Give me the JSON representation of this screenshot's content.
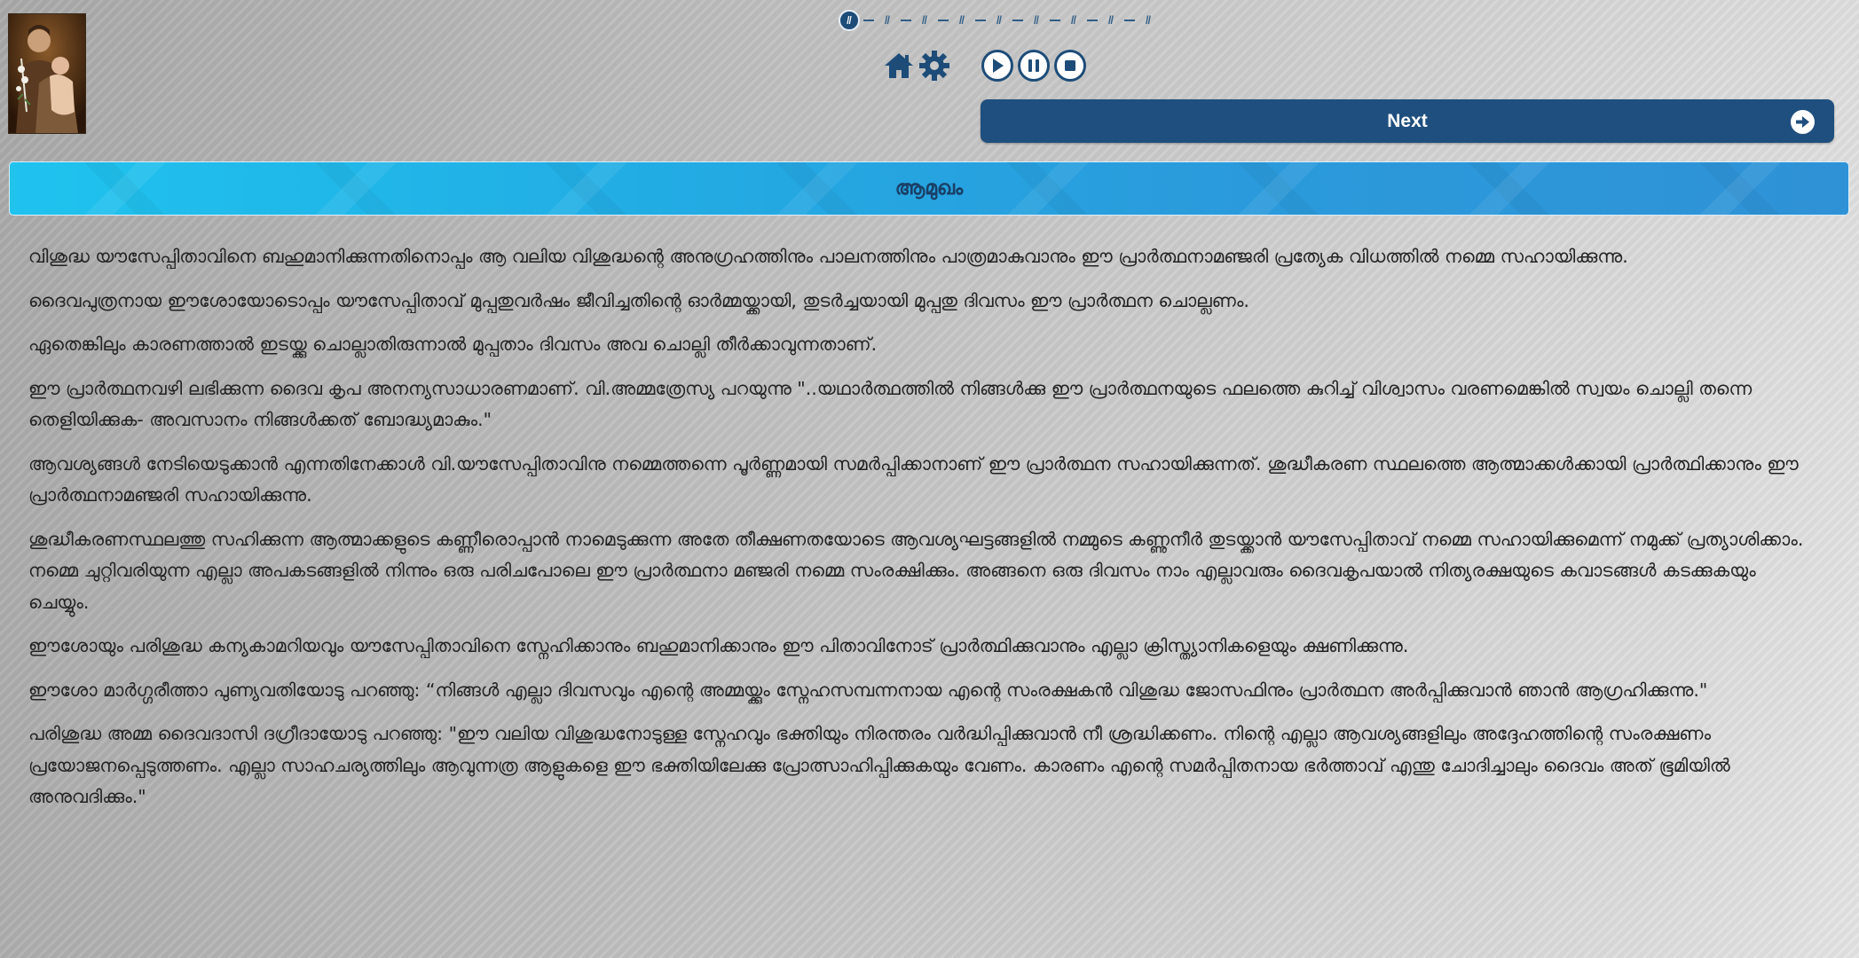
{
  "progress": {
    "steps": [
      "ǁ",
      "ǁ",
      "ǁ",
      "ǁ",
      "ǁ",
      "ǁ",
      "ǁ",
      "ǁ",
      "ǁ"
    ],
    "active_index": 0
  },
  "toolbar": {
    "icons": [
      "home-icon",
      "settings-icon"
    ],
    "media": [
      "play-icon",
      "pause-icon",
      "stop-icon"
    ]
  },
  "next_button": {
    "label": "Next"
  },
  "header": {
    "title": "ആമുഖം"
  },
  "paragraphs": [
    "വിശുദ്ധ യൗസേപ്പിതാവിനെ ബഹുമാനിക്കുന്നതിനൊപ്പം ആ വലിയ വിശുദ്ധന്റെ അനുഗ്രഹത്തിനും പാലനത്തിനും പാത്രമാകുവാനും ഈ പ്രാർത്ഥനാമഞ്ജരി പ്രത്യേക വിധത്തിൽ നമ്മെ സഹായിക്കുന്നു.",
    "ദൈവപുത്രനായ ഈശോയോടൊപ്പം യൗസേപ്പിതാവ് മുപ്പതുവർഷം ജീവിച്ചതിന്റെ ഓർമ്മയ്ക്കായി,  തുടർച്ചയായി മുപ്പതു ദിവസം ഈ പ്രാർത്ഥന ചൊല്ലണം.",
    "ഏതെങ്കിലും കാരണത്താൽ ഇടയ്ക്കു ചൊല്ലാതിരുന്നാൽ മുപ്പതാം ദിവസം അവ ചൊല്ലി തീർക്കാവുന്നതാണ്.",
    "ഈ പ്രാർത്ഥനവഴി ലഭിക്കുന്ന ദൈവ കൃപ അനന്യസാധാരണമാണ്. വി.അമ്മത്രേസ്യ പറയുന്നു \"..യഥാർത്ഥത്തിൽ നിങ്ങൾക്കു ഈ പ്രാർത്ഥനയുടെ  ഫലത്തെ കുറിച്ച്  വിശ്വാസം വരണമെങ്കിൽ സ്വയം ചൊല്ലി തന്നെ തെളിയിക്കുക- അവസാനം നിങ്ങൾക്കത് ബോദ്ധ്യമാകും.\"",
    "ആവശ്യങ്ങൾ നേടിയെടുക്കാൻ എന്നതിനേക്കാൾ വി.യൗസേപ്പിതാവിനു  നമ്മെത്തന്നെ പൂർണ്ണമായി സമർപ്പിക്കാനാണ് ഈ പ്രാർത്ഥന സഹായിക്കുന്നത്. ശുദ്ധീകരണ സ്ഥലത്തെ ആത്മാക്കൾക്കായി പ്രാർത്ഥിക്കാനും ഈ പ്രാർത്ഥനാമഞ്ജരി സഹായിക്കുന്നു.",
    "ശുദ്ധീകരണസ്ഥലത്തു സഹിക്കുന്ന ആത്മാക്കളുടെ കണ്ണീരൊപ്പാൻ നാമെടുക്കുന്ന  അതേ തീക്ഷണതയോടെ ആവശ്യഘട്ടങ്ങളിൽ നമ്മുടെ കണ്ണുനീർ തുടയ്ക്കാൻ യൗസേപ്പിതാവ് നമ്മെ സഹായിക്കുമെന്ന് നമുക്ക് പ്രത്യാശിക്കാം. നമ്മെ ചുറ്റിവരിയുന്ന എല്ലാ അപകടങ്ങളിൽ നിന്നും ഒരു പരിചപോലെ ഈ പ്രാർത്ഥനാ മഞ്ജരി നമ്മെ സംരക്ഷിക്കും. അങ്ങനെ ഒരു ദിവസം നാം എല്ലാവരും ദൈവകൃപയാൽ നിത്യരക്ഷയുടെ കവാടങ്ങൾ കടക്കുകയും ചെയ്യും.",
    "ഈശോയും പരിശുദ്ധ കന്യകാമറിയവും യൗസേപ്പിതാവിനെ സ്നേഹിക്കാനും ബഹുമാനിക്കാനും ഈ പിതാവിനോട് പ്രാർത്ഥിക്കുവാനും എല്ലാ ക്രിസ്ത്യാനികളെയും ക്ഷണിക്കുന്നു.",
    "ഈശോ മാർഗ്ഗരീത്താ പുണ്യവതിയോടു പറഞ്ഞു: “നിങ്ങൾ എല്ലാ ദിവസവും എന്റെ അമ്മയ്ക്കും സ്നേഹസമ്പന്നനായ എന്റെ  സംരക്ഷകൻ വിശുദ്ധ ജോസഫിനും പ്രാർത്ഥന അർപ്പിക്കുവാൻ ഞാൻ ആഗ്രഹിക്കുന്നു.\"",
    "പരിശുദ്ധ അമ്മ ദൈവദാസി ദഗ്രീദായോടു പറഞ്ഞു: \"ഈ വലിയ വിശുദ്ധനോടുള്ള സ്നേഹവും ഭക്തിയും നിരന്തരം വർദ്ധിപ്പിക്കുവാൻ  നീ ശ്രദ്ധിക്കണം. നിന്റെ എല്ലാ ആവശ്യങ്ങളിലും അദ്ദേഹത്തിന്റെ സംരക്ഷണം പ്രയോജനപ്പെടുത്തണം. എല്ലാ സാഹചര്യത്തിലും ആവുന്നത്ര ആളുകളെ ഈ ഭക്തിയിലേക്കു പ്രോത്സാഹിപ്പിക്കുകയും വേണം. കാരണം എന്റെ സമർപ്പിതനായ ഭർത്താവ് എന്തു ചോദിച്ചാലും ദൈവം അത് ഭൂമിയിൽ അനുവദിക്കും.\""
  ]
}
